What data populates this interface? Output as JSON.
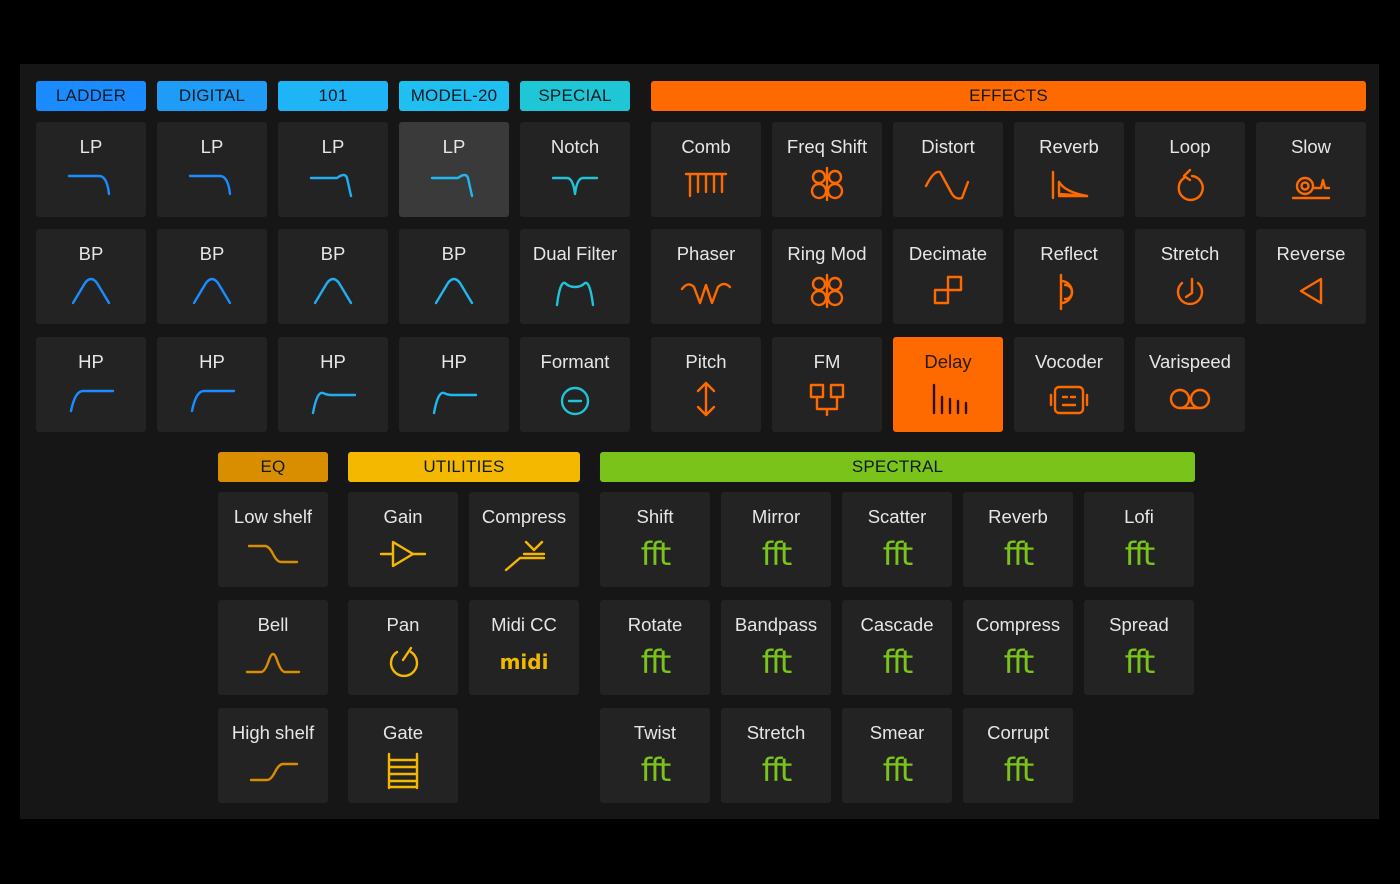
{
  "colors": {
    "ladder": "#1a8cff",
    "digital": "#1f9cf5",
    "c101": "#1fb4f5",
    "model20": "#1fbff0",
    "special": "#1fc6d6",
    "effects": "#ff6a00",
    "eq": "#d98e00",
    "utilities": "#f5b800",
    "spectral": "#7ac31a",
    "filter_icon_ladder": "#1a8cff",
    "filter_icon_digital": "#1a8cff",
    "filter_icon_101": "#20aef0",
    "filter_icon_model20": "#20b8f0",
    "filter_icon_special": "#20c4d8",
    "effects_icon": "#ff6a00",
    "eq_icon": "#d98e00",
    "utilities_icon": "#f5b800",
    "spectral_icon": "#7ac31a"
  },
  "headers": {
    "ladder": "LADDER",
    "digital": "DIGITAL",
    "c101": "101",
    "model20": "MODEL-20",
    "special": "SPECIAL",
    "effects": "EFFECTS",
    "eq": "EQ",
    "utilities": "UTILITIES",
    "spectral": "SPECTRAL"
  },
  "filters": {
    "ladder": [
      {
        "label": "LP",
        "icon": "lowpass-icon"
      },
      {
        "label": "BP",
        "icon": "bandpass-icon"
      },
      {
        "label": "HP",
        "icon": "highpass-icon"
      }
    ],
    "digital": [
      {
        "label": "LP",
        "icon": "lowpass-icon"
      },
      {
        "label": "BP",
        "icon": "bandpass-icon"
      },
      {
        "label": "HP",
        "icon": "highpass-icon"
      }
    ],
    "c101": [
      {
        "label": "LP",
        "icon": "lowpass-resonant-icon"
      },
      {
        "label": "BP",
        "icon": "bandpass-icon"
      },
      {
        "label": "HP",
        "icon": "highpass-resonant-icon"
      }
    ],
    "model20": [
      {
        "label": "LP",
        "icon": "lowpass-resonant-icon",
        "selected": true
      },
      {
        "label": "BP",
        "icon": "bandpass-icon"
      },
      {
        "label": "HP",
        "icon": "highpass-resonant-icon"
      }
    ],
    "special": [
      {
        "label": "Notch",
        "icon": "notch-icon"
      },
      {
        "label": "Dual Filter",
        "icon": "dual-filter-icon"
      },
      {
        "label": "Formant",
        "icon": "formant-icon"
      }
    ]
  },
  "effects": [
    {
      "label": "Comb",
      "icon": "comb-icon"
    },
    {
      "label": "Freq Shift",
      "icon": "freq-shift-icon"
    },
    {
      "label": "Distort",
      "icon": "distort-icon"
    },
    {
      "label": "Reverb",
      "icon": "reverb-icon"
    },
    {
      "label": "Loop",
      "icon": "loop-icon"
    },
    {
      "label": "Slow",
      "icon": "snail-icon"
    },
    {
      "label": "Phaser",
      "icon": "phaser-icon"
    },
    {
      "label": "Ring Mod",
      "icon": "ring-mod-icon"
    },
    {
      "label": "Decimate",
      "icon": "decimate-icon"
    },
    {
      "label": "Reflect",
      "icon": "reflect-icon"
    },
    {
      "label": "Stretch",
      "icon": "stretch-icon"
    },
    {
      "label": "Reverse",
      "icon": "reverse-icon"
    },
    {
      "label": "Pitch",
      "icon": "pitch-icon"
    },
    {
      "label": "FM",
      "icon": "fm-icon"
    },
    {
      "label": "Delay",
      "icon": "delay-icon",
      "selected": true
    },
    {
      "label": "Vocoder",
      "icon": "robot-icon"
    },
    {
      "label": "Varispeed",
      "icon": "tape-icon"
    }
  ],
  "eq": [
    {
      "label": "Low shelf",
      "icon": "low-shelf-icon"
    },
    {
      "label": "Bell",
      "icon": "bell-icon"
    },
    {
      "label": "High shelf",
      "icon": "high-shelf-icon"
    }
  ],
  "utilities": [
    {
      "label": "Gain",
      "icon": "gain-icon"
    },
    {
      "label": "Compress",
      "icon": "compress-icon"
    },
    {
      "label": "Pan",
      "icon": "pan-icon"
    },
    {
      "label": "Midi CC",
      "icon": "midi-icon",
      "glyph": "midi"
    },
    {
      "label": "Gate",
      "icon": "gate-icon"
    }
  ],
  "spectral": [
    {
      "label": "Shift",
      "glyph": "fft"
    },
    {
      "label": "Mirror",
      "glyph": "fft"
    },
    {
      "label": "Scatter",
      "glyph": "fft"
    },
    {
      "label": "Reverb",
      "glyph": "fft"
    },
    {
      "label": "Lofi",
      "glyph": "fft"
    },
    {
      "label": "Rotate",
      "glyph": "fft"
    },
    {
      "label": "Bandpass",
      "glyph": "fft"
    },
    {
      "label": "Cascade",
      "glyph": "fft"
    },
    {
      "label": "Compress",
      "glyph": "fft"
    },
    {
      "label": "Spread",
      "glyph": "fft"
    },
    {
      "label": "Twist",
      "glyph": "fft"
    },
    {
      "label": "Stretch",
      "glyph": "fft"
    },
    {
      "label": "Smear",
      "glyph": "fft"
    },
    {
      "label": "Corrupt",
      "glyph": "fft"
    }
  ]
}
